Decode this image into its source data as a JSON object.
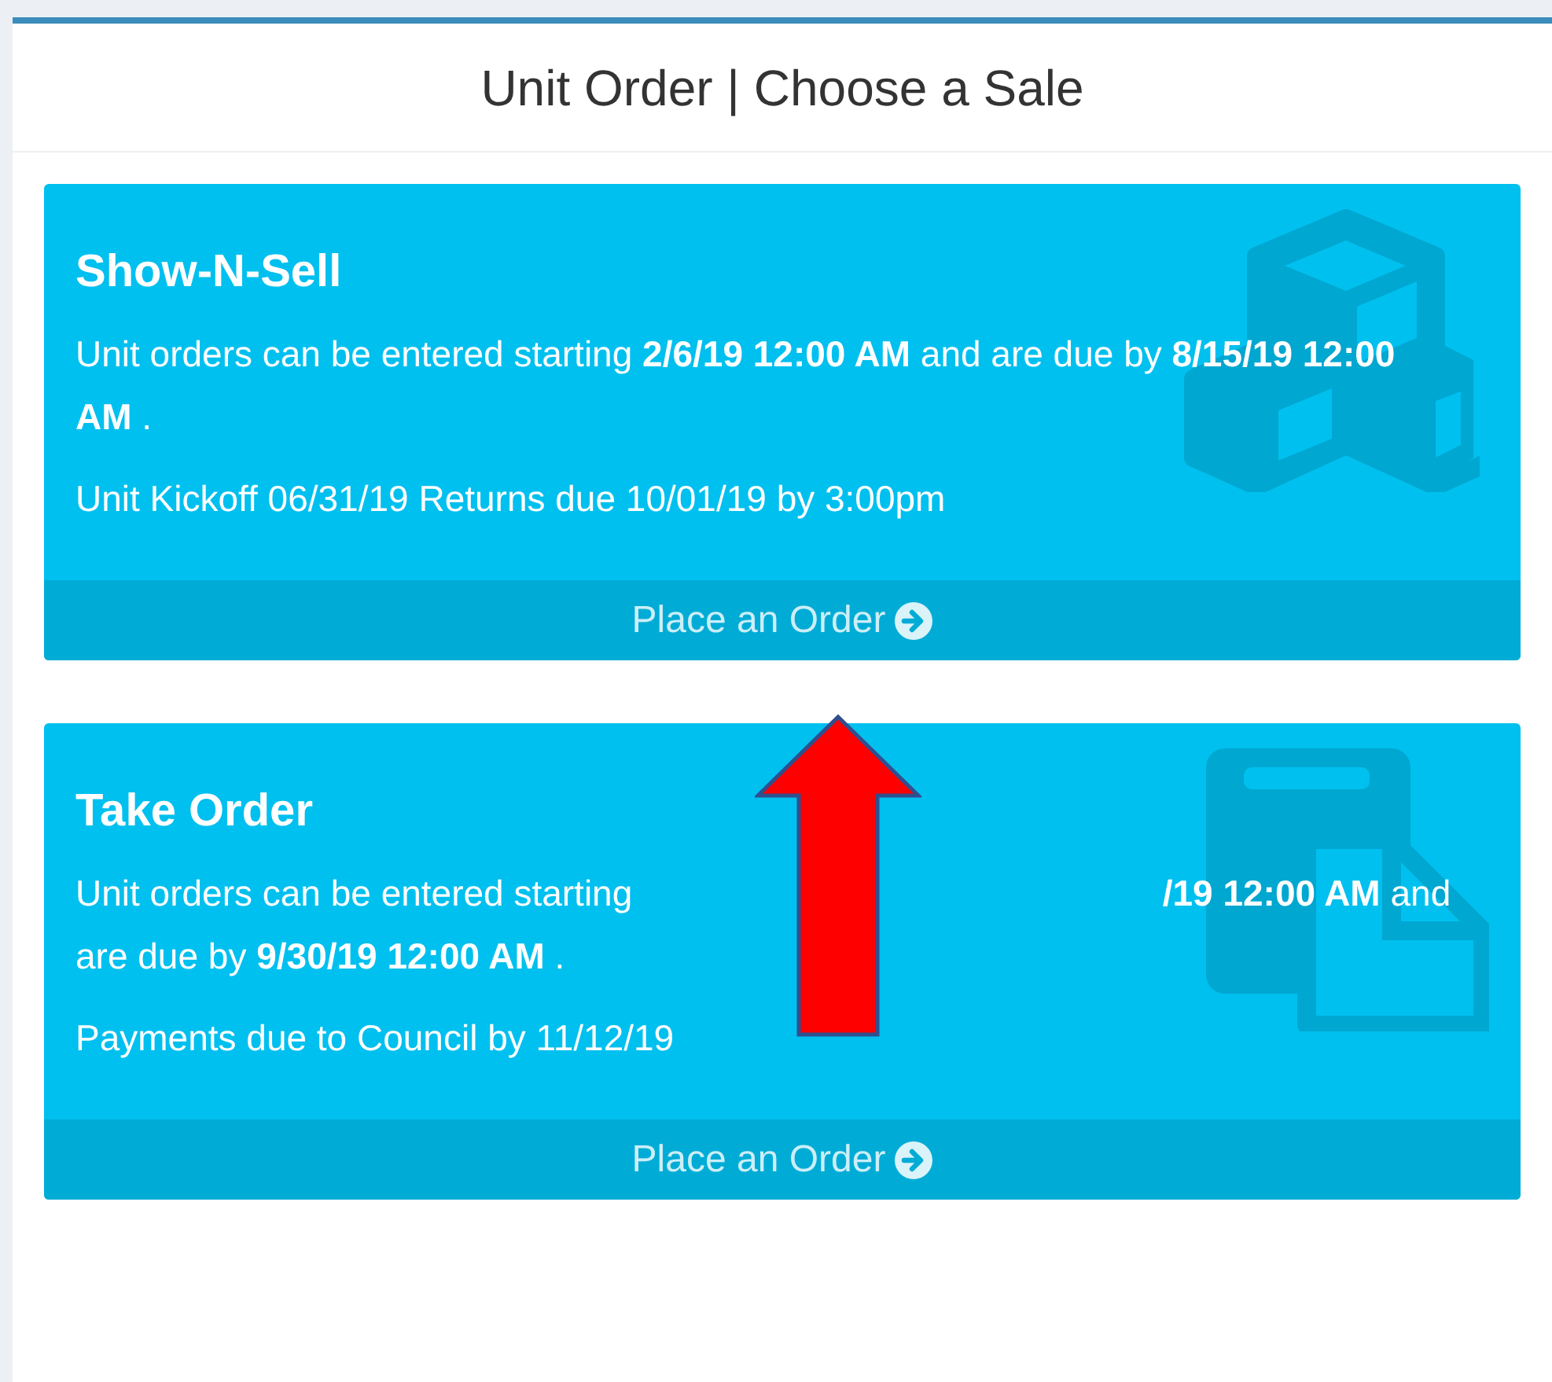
{
  "header": {
    "title": "Unit Order | Choose a Sale"
  },
  "sales": [
    {
      "title": "Show-N-Sell",
      "kind": "cubes",
      "description": [
        "Unit orders can be entered starting **2/6/19 12:00 AM** and are due by **8/15/19 12:00 AM** ."
      ],
      "note": "Unit Kickoff 06/31/19 Returns due 10/01/19 by 3:00pm",
      "action": "Place an Order"
    },
    {
      "title": "Take Order",
      "kind": "documents",
      "description": [
        "Unit orders can be entered starting",
        "**/19 12:00 AM** and are due by **9/30/19 12:00 AM** ."
      ],
      "note": "Payments due to Council by 11/12/19",
      "action": "Place an Order"
    }
  ],
  "annotation": {
    "kind": "arrow"
  }
}
